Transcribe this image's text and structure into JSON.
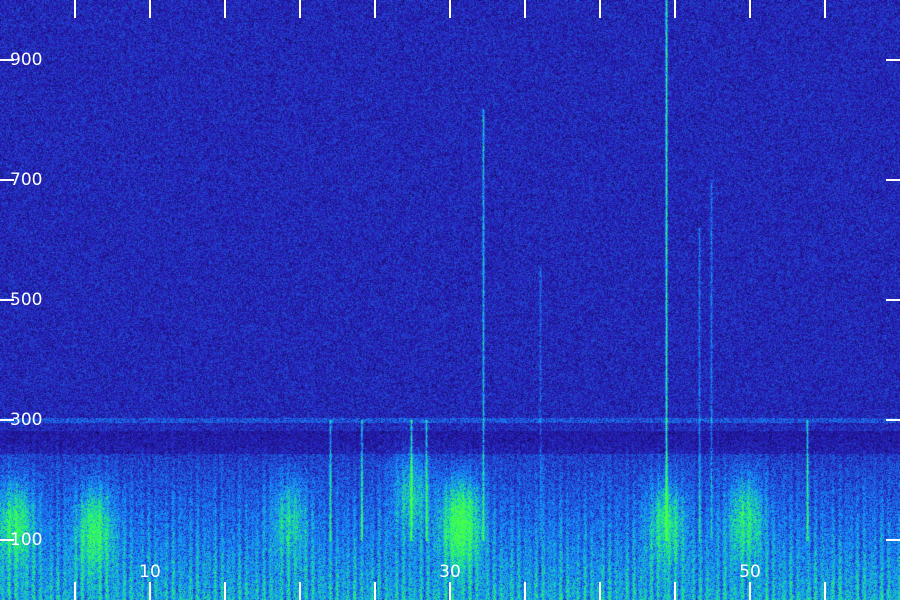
{
  "chart_data": {
    "type": "heatmap",
    "title": "",
    "xlabel": "",
    "ylabel": "",
    "grid": false,
    "xlim": [
      0,
      60
    ],
    "ylim": [
      0,
      1000
    ],
    "x_ticks": [
      {
        "value": 5,
        "label": ""
      },
      {
        "value": 10,
        "label": "10"
      },
      {
        "value": 15,
        "label": ""
      },
      {
        "value": 20,
        "label": ""
      },
      {
        "value": 25,
        "label": ""
      },
      {
        "value": 30,
        "label": "30"
      },
      {
        "value": 35,
        "label": ""
      },
      {
        "value": 40,
        "label": ""
      },
      {
        "value": 45,
        "label": ""
      },
      {
        "value": 50,
        "label": "50"
      },
      {
        "value": 55,
        "label": ""
      }
    ],
    "y_ticks": [
      {
        "value": 100,
        "label": "100"
      },
      {
        "value": 300,
        "label": "300"
      },
      {
        "value": 500,
        "label": "500"
      },
      {
        "value": 700,
        "label": "700"
      },
      {
        "value": 900,
        "label": "900"
      }
    ],
    "features": {
      "band_edge": 300,
      "vertical_lines": [
        {
          "x": 32.2,
          "from": 100,
          "to": 820,
          "intensity": 0.35
        },
        {
          "x": 44.4,
          "from": 100,
          "to": 1000,
          "intensity": 0.55
        },
        {
          "x": 24.1,
          "from": 100,
          "to": 300,
          "intensity": 0.4
        },
        {
          "x": 27.4,
          "from": 100,
          "to": 300,
          "intensity": 0.45
        },
        {
          "x": 28.4,
          "from": 100,
          "to": 300,
          "intensity": 0.35
        },
        {
          "x": 22.0,
          "from": 100,
          "to": 300,
          "intensity": 0.3
        },
        {
          "x": 46.6,
          "from": 100,
          "to": 620,
          "intensity": 0.2
        },
        {
          "x": 47.4,
          "from": 100,
          "to": 700,
          "intensity": 0.2
        },
        {
          "x": 36.0,
          "from": 100,
          "to": 560,
          "intensity": 0.15
        },
        {
          "x": 53.8,
          "from": 100,
          "to": 300,
          "intensity": 0.4
        }
      ],
      "hotspots": [
        {
          "x": 30.7,
          "y": 130,
          "intensity": 1.0
        },
        {
          "x": 6.3,
          "y": 120,
          "intensity": 0.7
        },
        {
          "x": 1.0,
          "y": 130,
          "intensity": 0.7
        },
        {
          "x": 49.7,
          "y": 140,
          "intensity": 0.6
        },
        {
          "x": 44.4,
          "y": 130,
          "intensity": 0.6
        },
        {
          "x": 27.4,
          "y": 180,
          "intensity": 0.5
        },
        {
          "x": 19.3,
          "y": 140,
          "intensity": 0.45
        }
      ]
    },
    "colors": {
      "background": "#2a1e8a",
      "low": "#1a0f5c",
      "mid": "#1f5fff",
      "high": "#1fe08a",
      "peak": "#3dff5a",
      "tick": "#ffffff"
    }
  }
}
